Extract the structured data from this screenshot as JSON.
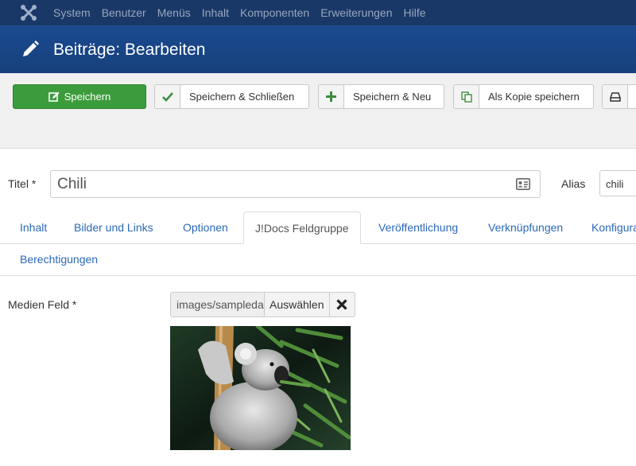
{
  "topnav": {
    "logo_icon": "joomla-logo-icon",
    "items": [
      "System",
      "Benutzer",
      "Menüs",
      "Inhalt",
      "Komponenten",
      "Erweiterungen",
      "Hilfe"
    ]
  },
  "header": {
    "icon": "pencil-icon",
    "title": "Beiträge: Bearbeiten"
  },
  "toolbar": {
    "save": "Speichern",
    "save_close": "Speichern & Schließen",
    "save_new": "Speichern & Neu",
    "save_copy": "Als Kopie speichern"
  },
  "form": {
    "title_label": "Titel *",
    "title_value": "Chili",
    "alias_label": "Alias",
    "alias_value": "chili"
  },
  "tabs": [
    "Inhalt",
    "Bilder und Links",
    "Optionen",
    "J!Docs Feldgruppe",
    "Veröffentlichung",
    "Verknüpfungen",
    "Konfiguration",
    "Berechtigungen"
  ],
  "active_tab": "J!Docs Feldgruppe",
  "media": {
    "label": "Medien Feld *",
    "path": "images/sampledata",
    "select": "Auswählen",
    "clear_icon": "close-icon",
    "preview_alt": "koala-photo"
  },
  "colors": {
    "nav": "#1a3867",
    "header": "#17407c",
    "save": "#3c9c3c",
    "link": "#2a69b8"
  }
}
